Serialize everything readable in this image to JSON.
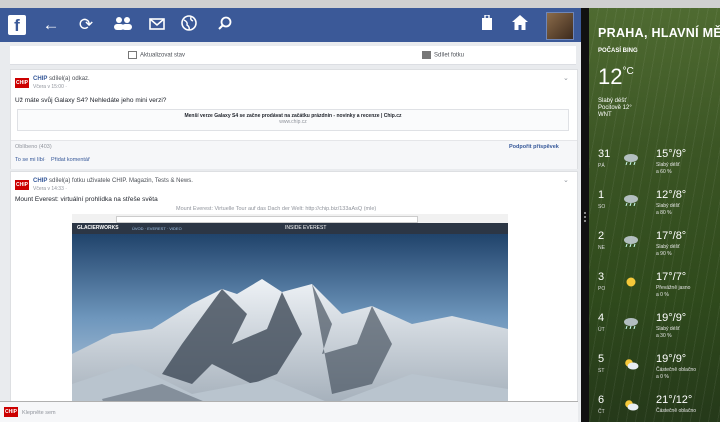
{
  "facebook": {
    "logo_glyph": "f",
    "status_prompt": "Aktualizovat stav",
    "share_photo": "Sdílet fotku",
    "post1": {
      "author": "CHIP",
      "action": "sdílel(a) odkaz.",
      "meta": "Včera v 15:00 · ",
      "text": "Už máte svůj Galaxy S4? Nehledáte jeho mini verzi?",
      "link_title": "Menší verze Galaxy S4 se začne prodávat na začátku prázdnin - novinky a recenze | Chip.cz",
      "link_domain": "www.chip.cz",
      "comments_label": "Oblíbeno (403)",
      "support": "Podpořit příspěvek",
      "like": "To se mi líbí",
      "comment": "Přidat komentář"
    },
    "post2": {
      "author": "CHIP",
      "action": "sdílel(a) fotku uživatele CHIP. Magazin, Tests & News.",
      "meta": "Včera v 14:33 · ",
      "text": "Mount Everest: virtuální prohlídka na střeše světa",
      "caption": "Mount Everest: Virtuelle Tour auf das Dach der Welt: http://chip.biz/133aAsQ (mle)"
    },
    "bottom_placeholder": "Klepněte sem"
  },
  "weather": {
    "city": "PRAHA, HLAVNÍ MĚ",
    "source": "POČASÍ BING",
    "current_temp": "12",
    "unit": "°C",
    "condition": "Slabý déšť",
    "feels": "Pocitově 12°",
    "wind": "WNT",
    "days": [
      {
        "num": "31",
        "name": "PÁ",
        "temp": "15°/9°",
        "desc": "Slabý déšť",
        "prob": "a 60 %",
        "icon": "rain"
      },
      {
        "num": "1",
        "name": "SO",
        "temp": "12°/8°",
        "desc": "Slabý déšť",
        "prob": "a 80 %",
        "icon": "rain"
      },
      {
        "num": "2",
        "name": "NE",
        "temp": "17°/8°",
        "desc": "Slabý déšť",
        "prob": "a 90 %",
        "icon": "rain"
      },
      {
        "num": "3",
        "name": "PO",
        "temp": "17°/7°",
        "desc": "Převážně jasno",
        "prob": "a 0 %",
        "icon": "sun"
      },
      {
        "num": "4",
        "name": "ÚT",
        "temp": "19°/9°",
        "desc": "Slabý déšť",
        "prob": "a 30 %",
        "icon": "rain"
      },
      {
        "num": "5",
        "name": "ST",
        "temp": "19°/9°",
        "desc": "Částečně oblačno",
        "prob": "a 0 %",
        "icon": "partly"
      },
      {
        "num": "6",
        "name": "ČT",
        "temp": "21°/12°",
        "desc": "Částečně oblačno",
        "prob": "",
        "icon": "partly"
      }
    ]
  },
  "screenshot": {
    "brand": "GLACIERWORKS",
    "site_title": "INSIDE EVEREST",
    "site_nav": "ÚVOD · EVEREST · VIDEO"
  }
}
